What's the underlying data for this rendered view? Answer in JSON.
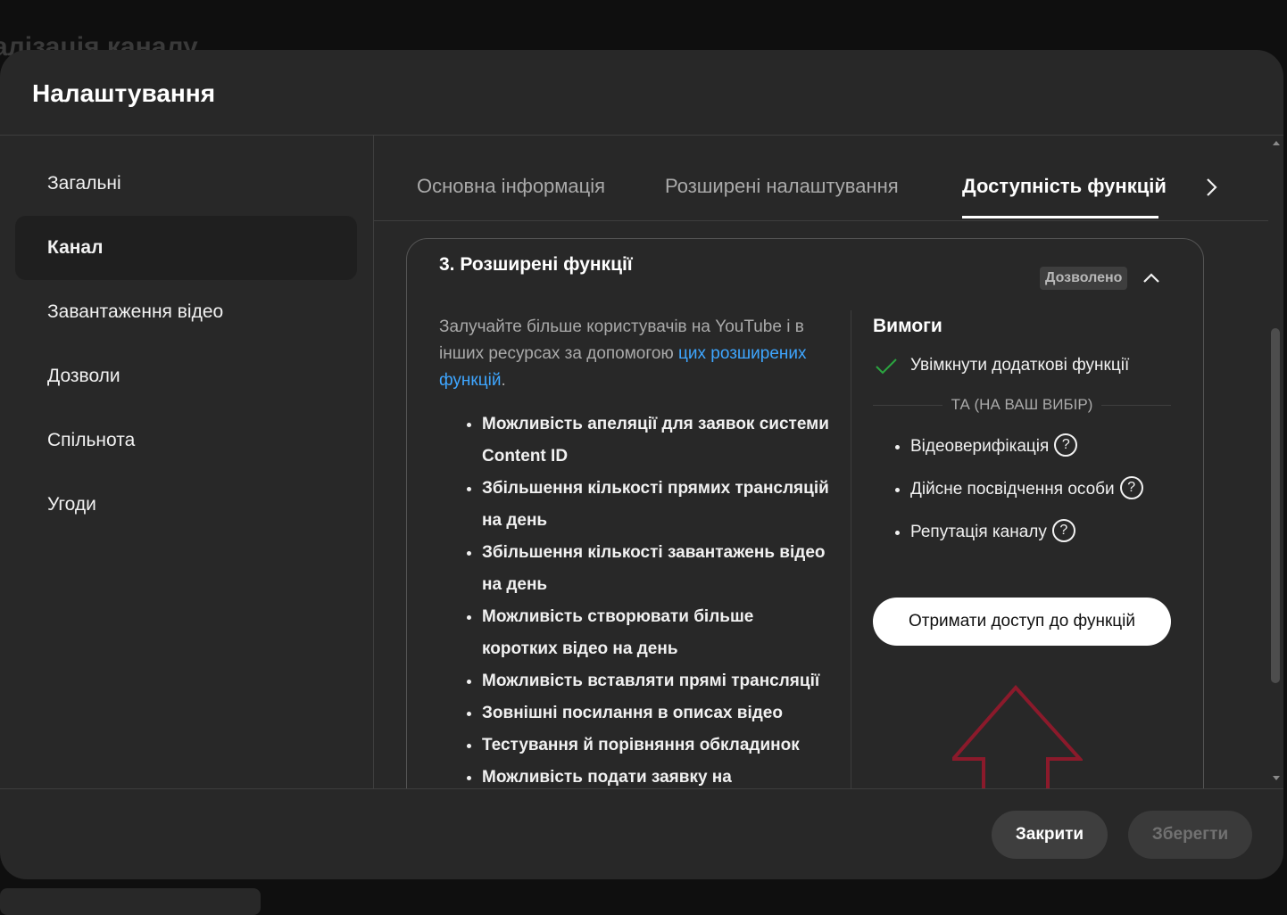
{
  "background": {
    "page_title": "алізація каналу"
  },
  "dialog": {
    "title": "Налаштування",
    "sidebar": {
      "items": [
        {
          "label": "Загальні",
          "active": false
        },
        {
          "label": "Канал",
          "active": true
        },
        {
          "label": "Завантаження відео",
          "active": false
        },
        {
          "label": "Дозволи",
          "active": false
        },
        {
          "label": "Спільнота",
          "active": false
        },
        {
          "label": "Угоди",
          "active": false
        }
      ]
    },
    "tabs": [
      {
        "label": "Основна інформація",
        "active": false
      },
      {
        "label": "Розширені налаштування",
        "active": false
      },
      {
        "label": "Доступність функцій",
        "active": true
      }
    ],
    "tabs_next_icon": "chevron-right-icon",
    "section": {
      "title": "3. Розширені функції",
      "status_badge": "Дозволено",
      "collapse_icon": "chevron-up-icon",
      "description_before": "Залучайте більше користувачів на YouTube і в інших ресурсах за допомогою ",
      "description_link": "цих розширених функцій",
      "description_after": ".",
      "features": [
        "Можливість апеляції для заявок системи Content ID",
        "Збільшення кількості прямих трансляцій на день",
        "Збільшення кількості завантажень відео на день",
        "Можливість створювати більше коротких відео на день",
        "Можливість вставляти прямі трансляції",
        "Зовнішні посилання в описах відео",
        "Тестування й порівняння обкладинок",
        "Можливість подати заявку на"
      ],
      "highlighted_feature_index": 6,
      "requirements": {
        "title": "Вимоги",
        "check_item": "Увімкнути додаткові функції",
        "or_label": "ТА (НА ВАШ ВИБІР)",
        "options": [
          "Відеоверифікація",
          "Дійсне посвідчення особи",
          "Репутація каналу"
        ],
        "help_icon_glyph": "?",
        "access_button": "Отримати доступ до функцій"
      }
    },
    "footer": {
      "close_button": "Закрити",
      "save_button": "Зберегти"
    }
  },
  "colors": {
    "dialog_bg": "#282828",
    "page_bg": "#0f0f0f",
    "link": "#3ea6ff",
    "check": "#2ba640",
    "annotation": "#8b1a2b"
  }
}
